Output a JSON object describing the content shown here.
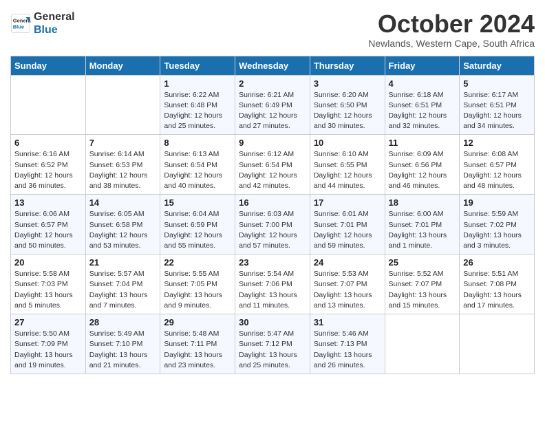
{
  "header": {
    "logo_line1": "General",
    "logo_line2": "Blue",
    "month_title": "October 2024",
    "location": "Newlands, Western Cape, South Africa"
  },
  "days_of_week": [
    "Sunday",
    "Monday",
    "Tuesday",
    "Wednesday",
    "Thursday",
    "Friday",
    "Saturday"
  ],
  "weeks": [
    [
      {
        "num": "",
        "info": ""
      },
      {
        "num": "",
        "info": ""
      },
      {
        "num": "1",
        "info": "Sunrise: 6:22 AM\nSunset: 6:48 PM\nDaylight: 12 hours and 25 minutes."
      },
      {
        "num": "2",
        "info": "Sunrise: 6:21 AM\nSunset: 6:49 PM\nDaylight: 12 hours and 27 minutes."
      },
      {
        "num": "3",
        "info": "Sunrise: 6:20 AM\nSunset: 6:50 PM\nDaylight: 12 hours and 30 minutes."
      },
      {
        "num": "4",
        "info": "Sunrise: 6:18 AM\nSunset: 6:51 PM\nDaylight: 12 hours and 32 minutes."
      },
      {
        "num": "5",
        "info": "Sunrise: 6:17 AM\nSunset: 6:51 PM\nDaylight: 12 hours and 34 minutes."
      }
    ],
    [
      {
        "num": "6",
        "info": "Sunrise: 6:16 AM\nSunset: 6:52 PM\nDaylight: 12 hours and 36 minutes."
      },
      {
        "num": "7",
        "info": "Sunrise: 6:14 AM\nSunset: 6:53 PM\nDaylight: 12 hours and 38 minutes."
      },
      {
        "num": "8",
        "info": "Sunrise: 6:13 AM\nSunset: 6:54 PM\nDaylight: 12 hours and 40 minutes."
      },
      {
        "num": "9",
        "info": "Sunrise: 6:12 AM\nSunset: 6:54 PM\nDaylight: 12 hours and 42 minutes."
      },
      {
        "num": "10",
        "info": "Sunrise: 6:10 AM\nSunset: 6:55 PM\nDaylight: 12 hours and 44 minutes."
      },
      {
        "num": "11",
        "info": "Sunrise: 6:09 AM\nSunset: 6:56 PM\nDaylight: 12 hours and 46 minutes."
      },
      {
        "num": "12",
        "info": "Sunrise: 6:08 AM\nSunset: 6:57 PM\nDaylight: 12 hours and 48 minutes."
      }
    ],
    [
      {
        "num": "13",
        "info": "Sunrise: 6:06 AM\nSunset: 6:57 PM\nDaylight: 12 hours and 50 minutes."
      },
      {
        "num": "14",
        "info": "Sunrise: 6:05 AM\nSunset: 6:58 PM\nDaylight: 12 hours and 53 minutes."
      },
      {
        "num": "15",
        "info": "Sunrise: 6:04 AM\nSunset: 6:59 PM\nDaylight: 12 hours and 55 minutes."
      },
      {
        "num": "16",
        "info": "Sunrise: 6:03 AM\nSunset: 7:00 PM\nDaylight: 12 hours and 57 minutes."
      },
      {
        "num": "17",
        "info": "Sunrise: 6:01 AM\nSunset: 7:01 PM\nDaylight: 12 hours and 59 minutes."
      },
      {
        "num": "18",
        "info": "Sunrise: 6:00 AM\nSunset: 7:01 PM\nDaylight: 13 hours and 1 minute."
      },
      {
        "num": "19",
        "info": "Sunrise: 5:59 AM\nSunset: 7:02 PM\nDaylight: 13 hours and 3 minutes."
      }
    ],
    [
      {
        "num": "20",
        "info": "Sunrise: 5:58 AM\nSunset: 7:03 PM\nDaylight: 13 hours and 5 minutes."
      },
      {
        "num": "21",
        "info": "Sunrise: 5:57 AM\nSunset: 7:04 PM\nDaylight: 13 hours and 7 minutes."
      },
      {
        "num": "22",
        "info": "Sunrise: 5:55 AM\nSunset: 7:05 PM\nDaylight: 13 hours and 9 minutes."
      },
      {
        "num": "23",
        "info": "Sunrise: 5:54 AM\nSunset: 7:06 PM\nDaylight: 13 hours and 11 minutes."
      },
      {
        "num": "24",
        "info": "Sunrise: 5:53 AM\nSunset: 7:07 PM\nDaylight: 13 hours and 13 minutes."
      },
      {
        "num": "25",
        "info": "Sunrise: 5:52 AM\nSunset: 7:07 PM\nDaylight: 13 hours and 15 minutes."
      },
      {
        "num": "26",
        "info": "Sunrise: 5:51 AM\nSunset: 7:08 PM\nDaylight: 13 hours and 17 minutes."
      }
    ],
    [
      {
        "num": "27",
        "info": "Sunrise: 5:50 AM\nSunset: 7:09 PM\nDaylight: 13 hours and 19 minutes."
      },
      {
        "num": "28",
        "info": "Sunrise: 5:49 AM\nSunset: 7:10 PM\nDaylight: 13 hours and 21 minutes."
      },
      {
        "num": "29",
        "info": "Sunrise: 5:48 AM\nSunset: 7:11 PM\nDaylight: 13 hours and 23 minutes."
      },
      {
        "num": "30",
        "info": "Sunrise: 5:47 AM\nSunset: 7:12 PM\nDaylight: 13 hours and 25 minutes."
      },
      {
        "num": "31",
        "info": "Sunrise: 5:46 AM\nSunset: 7:13 PM\nDaylight: 13 hours and 26 minutes."
      },
      {
        "num": "",
        "info": ""
      },
      {
        "num": "",
        "info": ""
      }
    ]
  ]
}
